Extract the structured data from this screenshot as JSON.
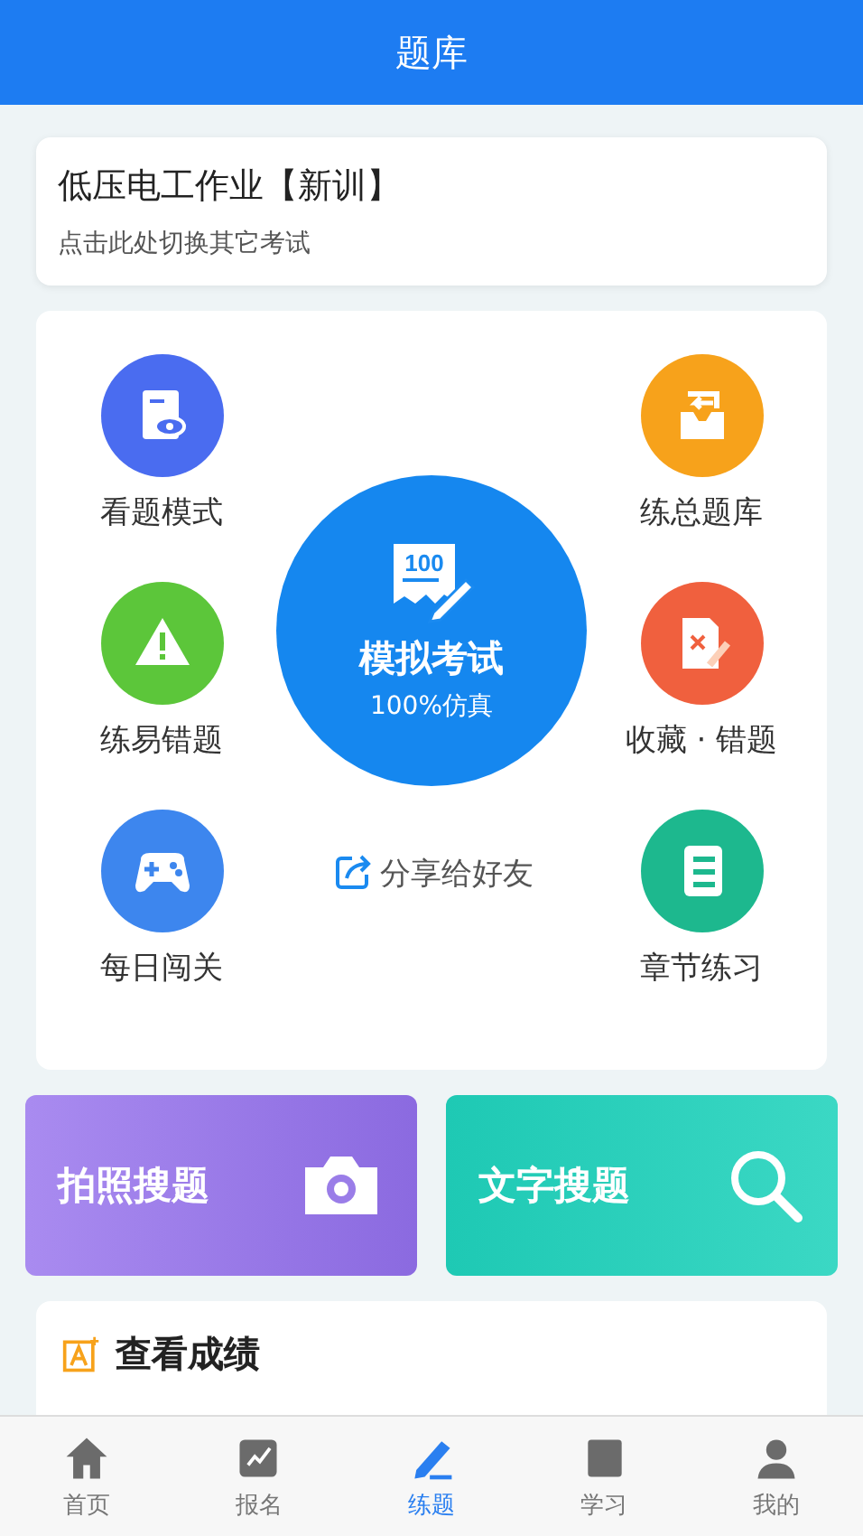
{
  "header": {
    "title": "题库"
  },
  "exam": {
    "name": "低压电工作业【新训】",
    "hint": "点击此处切换其它考试"
  },
  "features": [
    {
      "label": "看题模式",
      "kind": "view",
      "color": "#4a6cf0"
    },
    {
      "label": "练总题库",
      "kind": "bank",
      "color": "#f7a21b"
    },
    {
      "label": "练易错题",
      "kind": "warn",
      "color": "#5cc63a"
    },
    {
      "label": "收藏 · 错题",
      "kind": "wrong",
      "color": "#f0603e"
    },
    {
      "label": "每日闯关",
      "kind": "game",
      "color": "#3d86ee"
    },
    {
      "label": "章节练习",
      "kind": "chapter",
      "color": "#1db88e"
    }
  ],
  "mock": {
    "title": "模拟考试",
    "subtitle": "100%仿真",
    "score": "100"
  },
  "share": {
    "label": "分享给好友"
  },
  "search": [
    {
      "label": "拍照搜题",
      "kind": "photo"
    },
    {
      "label": "文字搜题",
      "kind": "text"
    }
  ],
  "scores": {
    "title": "查看成绩"
  },
  "tabs": [
    {
      "label": "首页",
      "kind": "home",
      "selected": false
    },
    {
      "label": "报名",
      "kind": "signup",
      "selected": false
    },
    {
      "label": "练题",
      "kind": "practice",
      "selected": true
    },
    {
      "label": "学习",
      "kind": "study",
      "selected": false
    },
    {
      "label": "我的",
      "kind": "mine",
      "selected": false
    }
  ]
}
